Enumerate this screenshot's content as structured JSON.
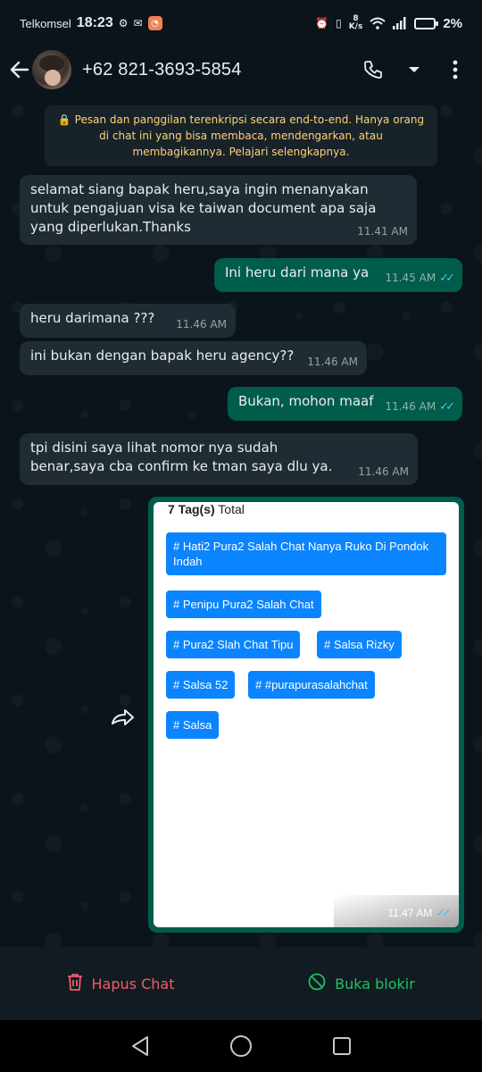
{
  "status_bar": {
    "carrier": "Telkomsel",
    "time": "18:23",
    "net_speed_value": "8",
    "net_speed_unit": "K/s",
    "battery": "2%"
  },
  "header": {
    "contact": "+62 821-3693-5854",
    "icons": [
      "back-arrow-icon",
      "avatar",
      "phone-icon",
      "chevron-down-icon",
      "more-vert-icon"
    ]
  },
  "encryption_notice": "🔒 Pesan dan panggilan terenkripsi secara end-to-end. Hanya orang di chat ini yang bisa membaca, mendengarkan, atau membagikannya. Pelajari selengkapnya.",
  "messages": [
    {
      "dir": "in",
      "text": "selamat siang bapak heru,saya ingin menanyakan untuk pengajuan visa ke taiwan document apa saja yang diperlukan.Thanks",
      "time": "11.41 AM"
    },
    {
      "dir": "out",
      "text": "Ini heru dari mana ya",
      "time": "11.45 AM",
      "ticks": "✓✓"
    },
    {
      "dir": "in",
      "text": "heru darimana ???",
      "time": "11.46 AM"
    },
    {
      "dir": "in",
      "text": "ini bukan dengan bapak heru agency??",
      "time": "11.46 AM"
    },
    {
      "dir": "out",
      "text": "Bukan, mohon maaf",
      "time": "11.46 AM",
      "ticks": "✓✓"
    },
    {
      "dir": "in",
      "text": "tpi disini saya lihat nomor nya sudah benar,saya cba confirm ke tman saya dlu ya.",
      "time": "11.46 AM"
    }
  ],
  "image_message": {
    "total_count": "7 Tag(s)",
    "total_label": "Total",
    "tags": [
      "# Hati2 Pura2 Salah Chat Nanya Ruko Di Pondok Indah",
      "# Penipu Pura2 Salah Chat",
      "# Pura2 Slah Chat Tipu",
      "# Salsa Rizky",
      "# Salsa 52",
      "# #purapurasalahchat",
      "# Salsa"
    ],
    "time": "11.47 AM",
    "ticks": "✓✓"
  },
  "actions": {
    "delete_label": "Hapus Chat",
    "unblock_label": "Buka blokir"
  },
  "colors": {
    "background": "#0b141a",
    "incoming_bubble": "#202c33",
    "outgoing_bubble": "#005c4b",
    "read_ticks": "#53bdeb",
    "encryption_text": "#ffd279",
    "tag_blue": "#0a84ff",
    "delete_red": "#f15c6d",
    "unblock_green": "#21c063"
  }
}
